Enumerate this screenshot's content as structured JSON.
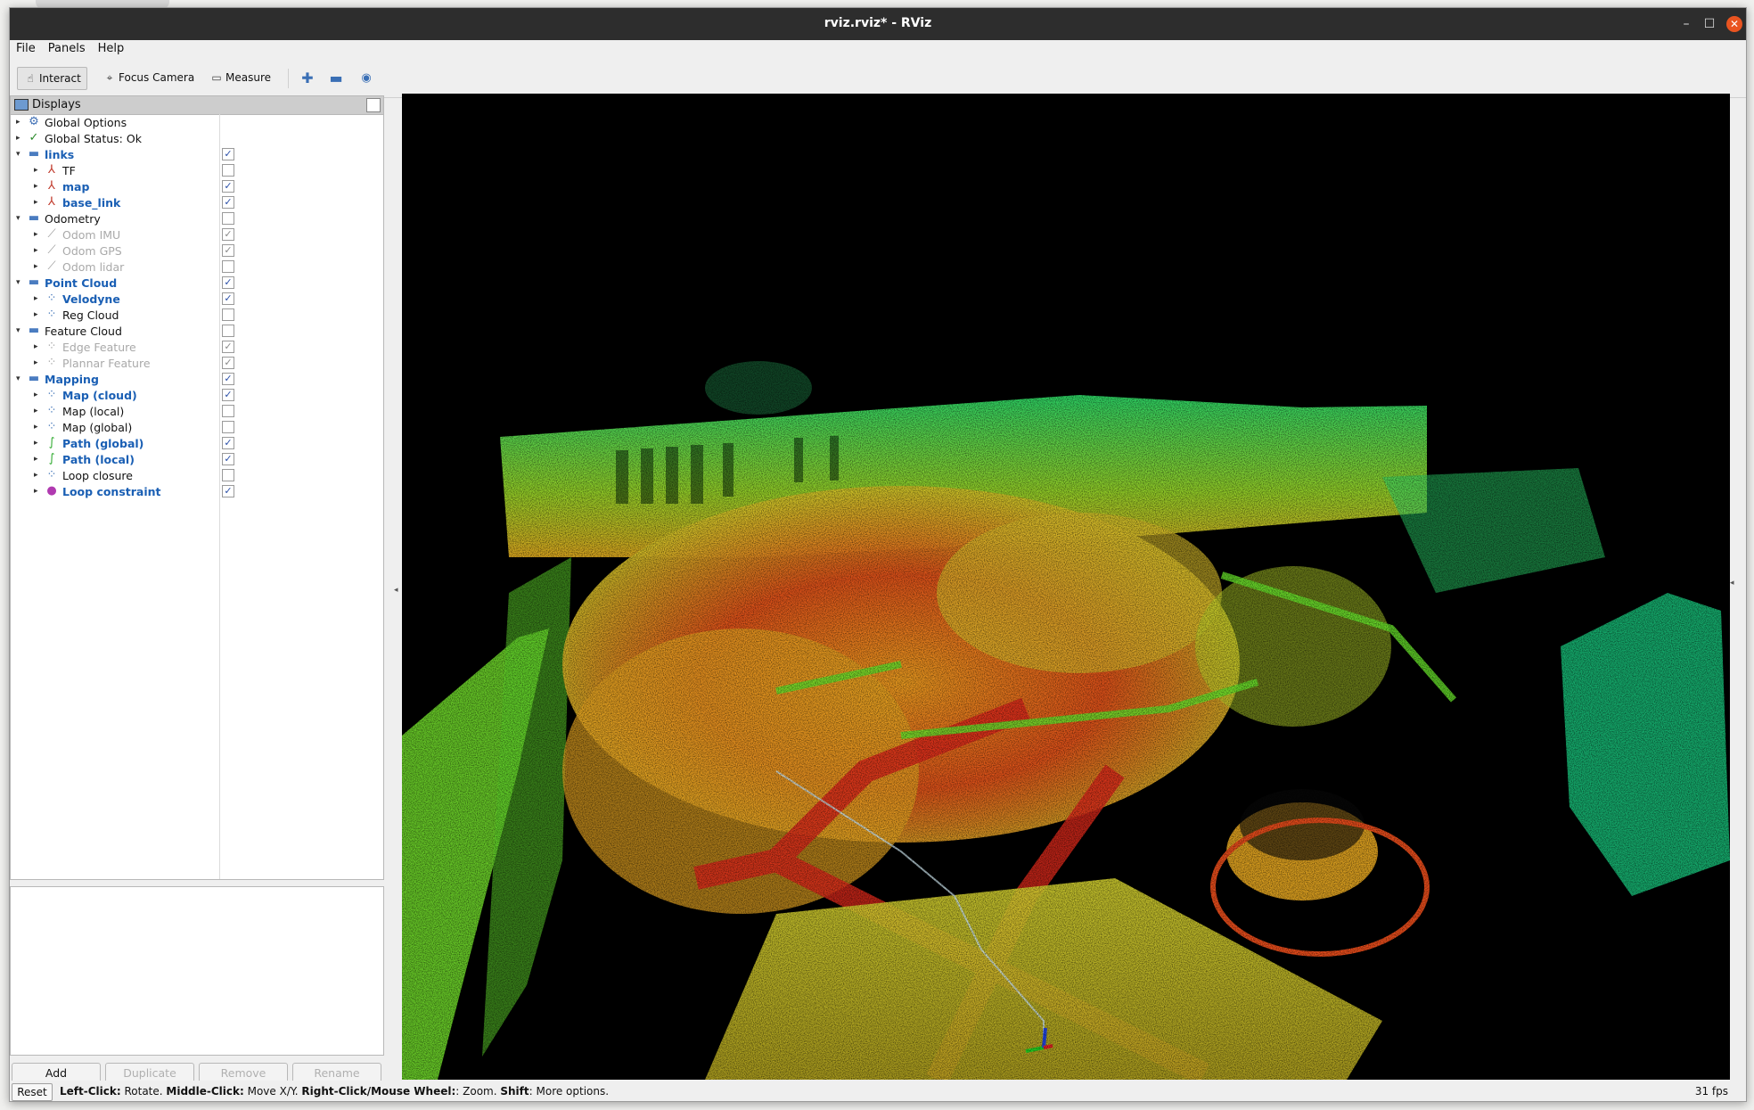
{
  "window": {
    "title": "rviz.rviz* - RViz",
    "controls": [
      "–",
      "☐",
      "✕"
    ]
  },
  "menu": [
    "File",
    "Panels",
    "Help"
  ],
  "toolbar": {
    "interact": "Interact",
    "focus_camera": "Focus Camera",
    "measure": "Measure"
  },
  "displays": {
    "title": "Displays",
    "rows": [
      {
        "label": "Global Options",
        "depth": 0,
        "arrow": "▸",
        "icon": "gear-icon",
        "glyph": "⚙",
        "color": "#3f6fb5",
        "style": "",
        "check": ""
      },
      {
        "label": "Global Status: Ok",
        "depth": 0,
        "arrow": "▸",
        "icon": "check-status-icon",
        "glyph": "✓",
        "color": "#2b8a2b",
        "style": "",
        "check": ""
      },
      {
        "label": "links",
        "depth": 0,
        "arrow": "▾",
        "icon": "folder-icon",
        "glyph": "▬",
        "color": "#4a7cc0",
        "style": "en",
        "check": "on"
      },
      {
        "label": "TF",
        "depth": 1,
        "arrow": "▸",
        "icon": "axes-icon",
        "glyph": "⅄",
        "color": "#c0392b",
        "style": "",
        "check": "off"
      },
      {
        "label": "map",
        "depth": 1,
        "arrow": "▸",
        "icon": "axes-icon",
        "glyph": "⅄",
        "color": "#c0392b",
        "style": "en",
        "check": "on"
      },
      {
        "label": "base_link",
        "depth": 1,
        "arrow": "▸",
        "icon": "axes-icon",
        "glyph": "⅄",
        "color": "#c0392b",
        "style": "en",
        "check": "on"
      },
      {
        "label": "Odometry",
        "depth": 0,
        "arrow": "▾",
        "icon": "folder-icon",
        "glyph": "▬",
        "color": "#4a7cc0",
        "style": "",
        "check": "off"
      },
      {
        "label": "Odom IMU",
        "depth": 1,
        "arrow": "▸",
        "icon": "odometry-icon",
        "glyph": "⟋",
        "color": "#9a9a9a",
        "style": "dis",
        "check": "grey"
      },
      {
        "label": "Odom GPS",
        "depth": 1,
        "arrow": "▸",
        "icon": "odometry-icon",
        "glyph": "⟋",
        "color": "#9a9a9a",
        "style": "dis",
        "check": "grey"
      },
      {
        "label": "Odom lidar",
        "depth": 1,
        "arrow": "▸",
        "icon": "odometry-icon",
        "glyph": "⟋",
        "color": "#9a9a9a",
        "style": "dis",
        "check": "off"
      },
      {
        "label": "Point Cloud",
        "depth": 0,
        "arrow": "▾",
        "icon": "folder-icon",
        "glyph": "▬",
        "color": "#4a7cc0",
        "style": "en",
        "check": "on"
      },
      {
        "label": "Velodyne",
        "depth": 1,
        "arrow": "▸",
        "icon": "pointcloud-icon",
        "glyph": "⁘",
        "color": "#3a6fb5",
        "style": "en",
        "check": "on"
      },
      {
        "label": "Reg Cloud",
        "depth": 1,
        "arrow": "▸",
        "icon": "pointcloud-icon",
        "glyph": "⁘",
        "color": "#3a6fb5",
        "style": "",
        "check": "off"
      },
      {
        "label": "Feature Cloud",
        "depth": 0,
        "arrow": "▾",
        "icon": "folder-icon",
        "glyph": "▬",
        "color": "#4a7cc0",
        "style": "",
        "check": "off"
      },
      {
        "label": "Edge Feature",
        "depth": 1,
        "arrow": "▸",
        "icon": "pointcloud-icon",
        "glyph": "⁘",
        "color": "#a0a0a0",
        "style": "dis",
        "check": "grey"
      },
      {
        "label": "Plannar Feature",
        "depth": 1,
        "arrow": "▸",
        "icon": "pointcloud-icon",
        "glyph": "⁘",
        "color": "#a0a0a0",
        "style": "dis",
        "check": "grey"
      },
      {
        "label": "Mapping",
        "depth": 0,
        "arrow": "▾",
        "icon": "folder-icon",
        "glyph": "▬",
        "color": "#4a7cc0",
        "style": "en",
        "check": "on"
      },
      {
        "label": "Map (cloud)",
        "depth": 1,
        "arrow": "▸",
        "icon": "pointcloud-icon",
        "glyph": "⁘",
        "color": "#3a6fb5",
        "style": "en",
        "check": "on"
      },
      {
        "label": "Map (local)",
        "depth": 1,
        "arrow": "▸",
        "icon": "pointcloud-icon",
        "glyph": "⁘",
        "color": "#3a6fb5",
        "style": "",
        "check": "off"
      },
      {
        "label": "Map (global)",
        "depth": 1,
        "arrow": "▸",
        "icon": "pointcloud-icon",
        "glyph": "⁘",
        "color": "#3a6fb5",
        "style": "",
        "check": "off"
      },
      {
        "label": "Path (global)",
        "depth": 1,
        "arrow": "▸",
        "icon": "path-icon",
        "glyph": "∫",
        "color": "#2eaa2e",
        "style": "en",
        "check": "on"
      },
      {
        "label": "Path (local)",
        "depth": 1,
        "arrow": "▸",
        "icon": "path-icon",
        "glyph": "∫",
        "color": "#2eaa2e",
        "style": "en",
        "check": "on"
      },
      {
        "label": "Loop closure",
        "depth": 1,
        "arrow": "▸",
        "icon": "pointcloud-icon",
        "glyph": "⁘",
        "color": "#3a6fb5",
        "style": "",
        "check": "off"
      },
      {
        "label": "Loop constraint",
        "depth": 1,
        "arrow": "▸",
        "icon": "marker-icon",
        "glyph": "●",
        "color": "#b03ab0",
        "style": "en",
        "check": "on"
      }
    ]
  },
  "panel_buttons": {
    "add": "Add",
    "duplicate": "Duplicate",
    "remove": "Remove",
    "rename": "Rename"
  },
  "status": {
    "reset": "Reset",
    "hint_parts": [
      {
        "b": "Left-Click:",
        "t": " Rotate. "
      },
      {
        "b": "Middle-Click:",
        "t": " Move X/Y. "
      },
      {
        "b": "Right-Click/Mouse Wheel:",
        "t": ": Zoom. "
      },
      {
        "b": "Shift",
        "t": ": More options."
      }
    ],
    "fps": "31 fps"
  }
}
